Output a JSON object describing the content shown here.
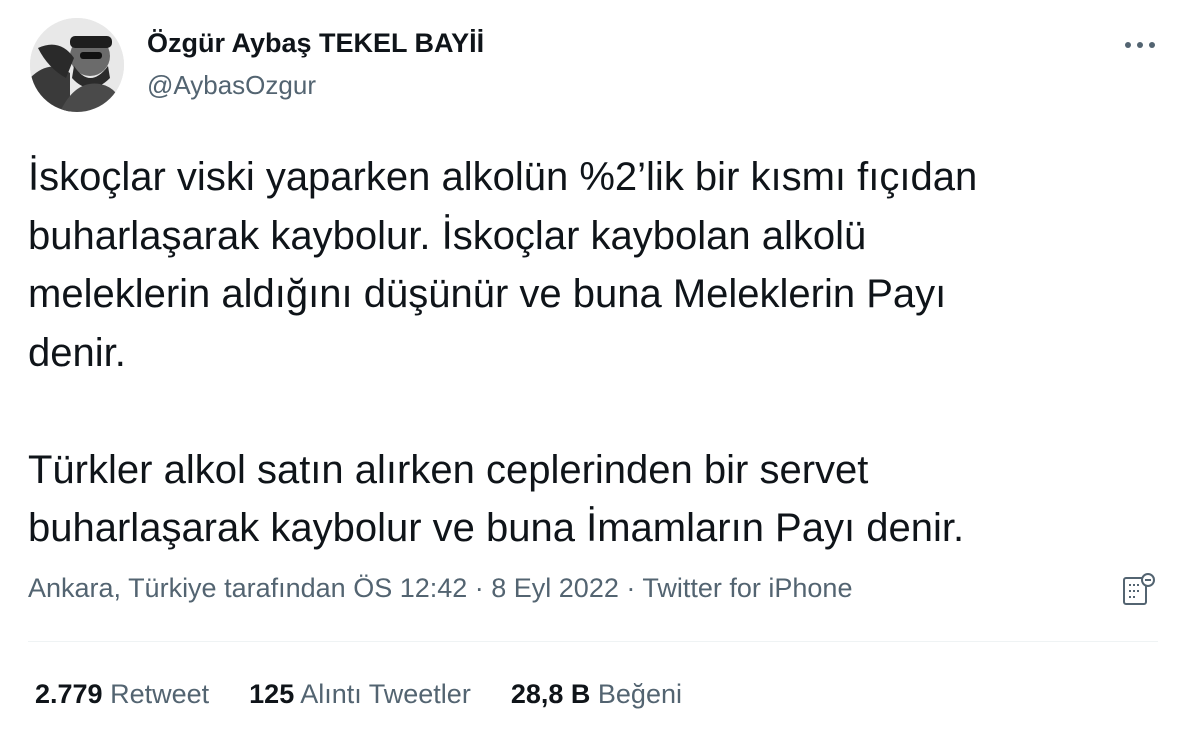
{
  "author": {
    "display_name": "Özgür Aybaş TEKEL BAYİİ",
    "handle": "@AybasOzgur"
  },
  "tweet": {
    "paragraphs": [
      "İskoçlar viski yaparken alkolün %2’lik bir kısmı fıçıdan\nbuharlaşarak kaybolur. İskoçlar kaybolan alkolü\nmeleklerin aldığını düşünür ve buna Meleklerin Payı\ndenir.",
      "Türkler alkol satın alırken ceplerinden bir servet\nbuharlaşarak kaybolur ve buna İmamların Payı denir."
    ]
  },
  "meta": {
    "location": "Ankara, Türkiye tarafından",
    "time": "ÖS 12:42",
    "sep1": " · ",
    "date": "8 Eyl 2022",
    "sep2": " · ",
    "source": "Twitter for iPhone"
  },
  "stats": {
    "retweets": {
      "count": "2.779",
      "label": "Retweet"
    },
    "quotes": {
      "count": "125",
      "label": "Alıntı Tweetler"
    },
    "likes": {
      "count": "28,8 B",
      "label": "Beğeni"
    }
  },
  "icons": {
    "more": "more-horizontal-icon",
    "analytics": "analytics-icon"
  },
  "colors": {
    "text": "#0f1419",
    "secondary": "#536471",
    "divider": "#eff3f4"
  }
}
